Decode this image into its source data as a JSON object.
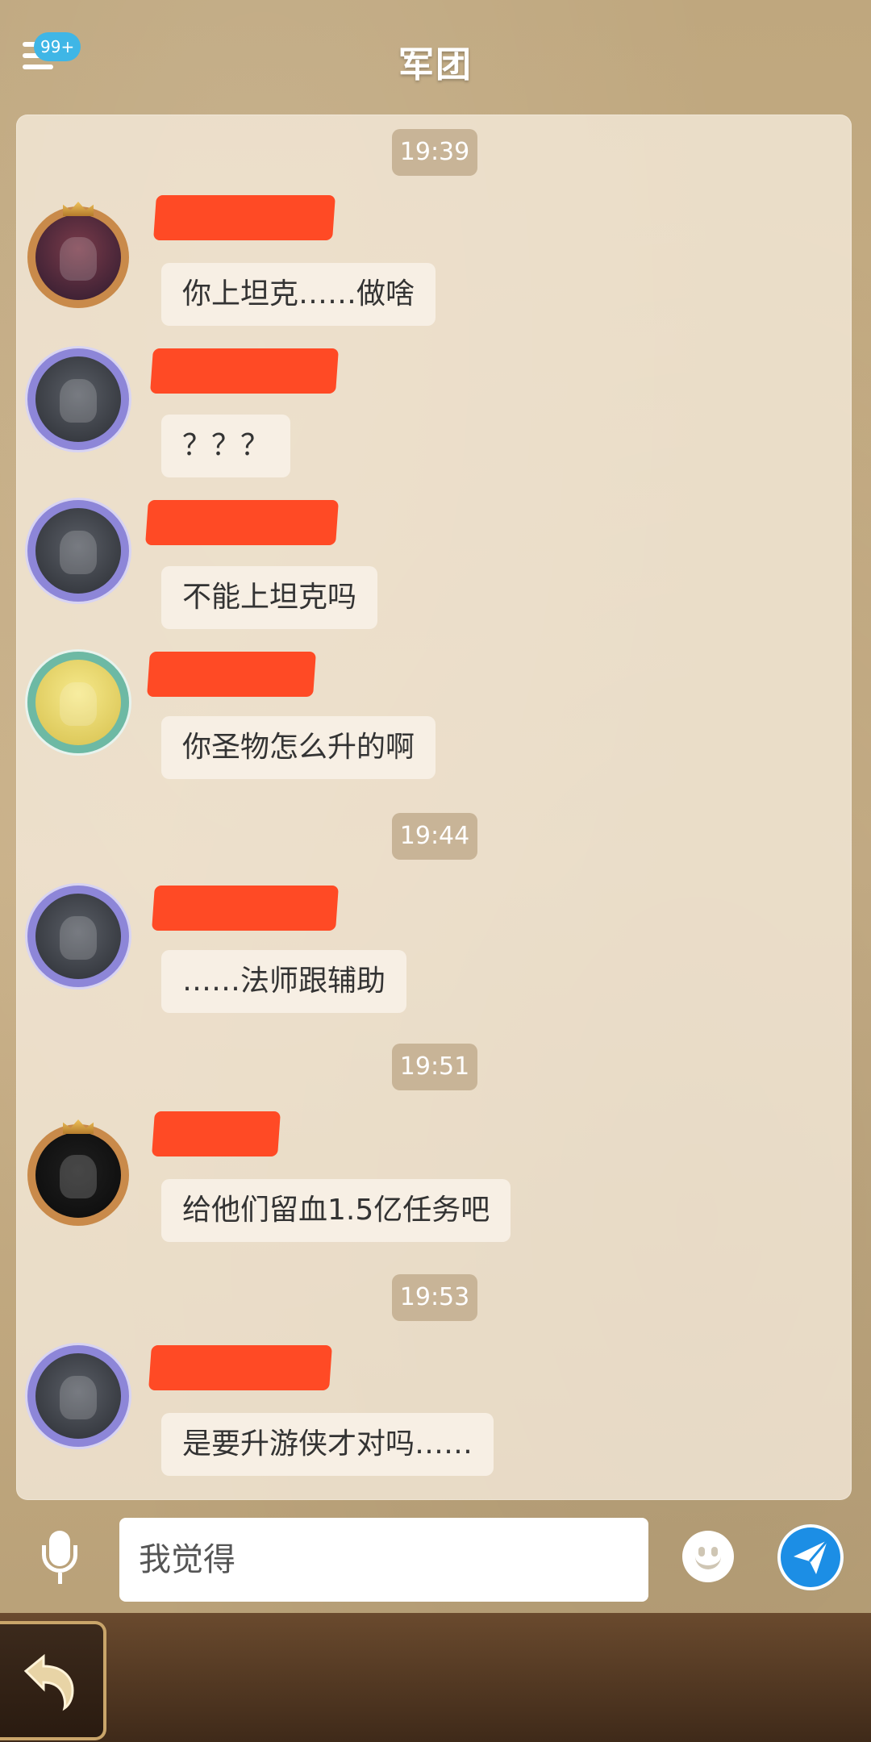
{
  "header": {
    "title": "军团",
    "badge": "99+"
  },
  "chat": {
    "timestamps": [
      "19:39",
      "19:44",
      "19:51",
      "19:53"
    ],
    "messages": [
      {
        "text": "你上坦克……做啥"
      },
      {
        "text": "？？？"
      },
      {
        "text": "不能上坦克吗"
      },
      {
        "text": "你圣物怎么升的啊"
      },
      {
        "text": "……法师跟辅助"
      },
      {
        "text": "给他们留血1.5亿任务吧"
      },
      {
        "text": "是要升游侠才对吗……"
      }
    ]
  },
  "input": {
    "value": "我觉得"
  },
  "icons": {
    "menu": "menu-icon",
    "mic": "mic-icon",
    "emoji": "emoji-icon",
    "send": "send-icon",
    "back": "back-arrow-icon"
  },
  "colors": {
    "badge": "#3fb6e6",
    "send_button": "#1c8ee5",
    "redaction": "#ff4a25"
  }
}
